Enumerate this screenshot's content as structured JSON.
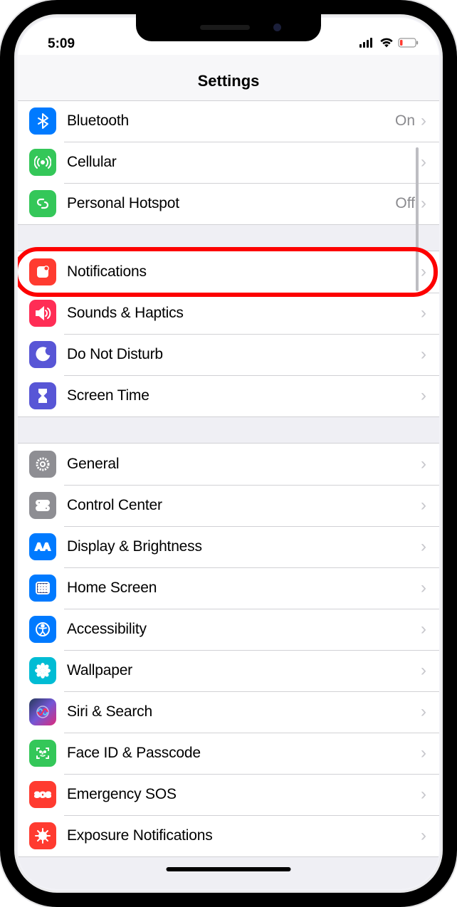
{
  "status": {
    "time": "5:09"
  },
  "nav": {
    "title": "Settings"
  },
  "groups": [
    {
      "rows": [
        {
          "id": "bluetooth",
          "label": "Bluetooth",
          "value": "On",
          "icon": "bluetooth",
          "color": "ic-blue"
        },
        {
          "id": "cellular",
          "label": "Cellular",
          "value": "",
          "icon": "antenna",
          "color": "ic-green"
        },
        {
          "id": "personal-hotspot",
          "label": "Personal Hotspot",
          "value": "Off",
          "icon": "link",
          "color": "ic-green"
        }
      ]
    },
    {
      "rows": [
        {
          "id": "notifications",
          "label": "Notifications",
          "value": "",
          "icon": "bell",
          "color": "ic-red",
          "highlighted": true
        },
        {
          "id": "sounds-haptics",
          "label": "Sounds & Haptics",
          "value": "",
          "icon": "speaker",
          "color": "ic-pink"
        },
        {
          "id": "do-not-disturb",
          "label": "Do Not Disturb",
          "value": "",
          "icon": "moon",
          "color": "ic-violet"
        },
        {
          "id": "screen-time",
          "label": "Screen Time",
          "value": "",
          "icon": "hourglass",
          "color": "ic-violet"
        }
      ]
    },
    {
      "rows": [
        {
          "id": "general",
          "label": "General",
          "value": "",
          "icon": "gear",
          "color": "ic-gray"
        },
        {
          "id": "control-center",
          "label": "Control Center",
          "value": "",
          "icon": "switches",
          "color": "ic-gray"
        },
        {
          "id": "display-brightness",
          "label": "Display & Brightness",
          "value": "",
          "icon": "aa",
          "color": "ic-blue"
        },
        {
          "id": "home-screen",
          "label": "Home Screen",
          "value": "",
          "icon": "grid",
          "color": "ic-blue"
        },
        {
          "id": "accessibility",
          "label": "Accessibility",
          "value": "",
          "icon": "access",
          "color": "ic-blue"
        },
        {
          "id": "wallpaper",
          "label": "Wallpaper",
          "value": "",
          "icon": "flower",
          "color": "ic-teal"
        },
        {
          "id": "siri-search",
          "label": "Siri & Search",
          "value": "",
          "icon": "siri",
          "color": "ic-grad"
        },
        {
          "id": "face-id-passcode",
          "label": "Face ID & Passcode",
          "value": "",
          "icon": "faceid",
          "color": "ic-green"
        },
        {
          "id": "emergency-sos",
          "label": "Emergency SOS",
          "value": "",
          "icon": "sos",
          "color": "ic-red"
        },
        {
          "id": "exposure-notif",
          "label": "Exposure Notifications",
          "value": "",
          "icon": "virus",
          "color": "ic-red"
        }
      ]
    }
  ]
}
